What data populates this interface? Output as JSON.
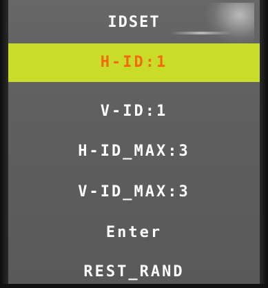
{
  "menu": {
    "title": "IDSET",
    "items": [
      {
        "label": "H-ID:1",
        "selected": true
      },
      {
        "label": "V-ID:1",
        "selected": false
      },
      {
        "label": "H-ID_MAX:3",
        "selected": false
      },
      {
        "label": "V-ID_MAX:3",
        "selected": false
      },
      {
        "label": "Enter",
        "selected": false
      },
      {
        "label": "REST_RAND",
        "selected": false
      }
    ]
  },
  "colors": {
    "osd_background": "#606060",
    "highlight_background": "#c9dc2a",
    "highlight_text": "#f26a0a",
    "text": "#ffffff"
  }
}
